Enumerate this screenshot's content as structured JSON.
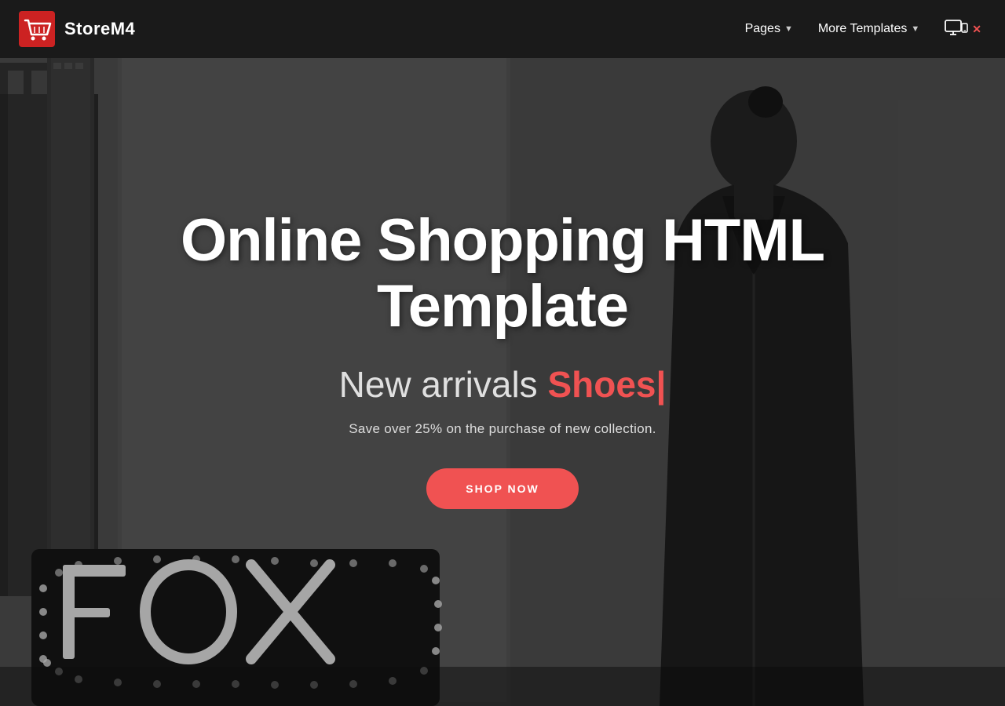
{
  "brand": {
    "name": "StoreM4",
    "icon_label": "shopping-cart-icon"
  },
  "navbar": {
    "pages_label": "Pages",
    "more_templates_label": "More Templates"
  },
  "hero": {
    "title": "Online Shopping HTML Template",
    "subtitle_prefix": "New arrivals ",
    "subtitle_highlight": "Shoes|",
    "description": "Save over 25% on the purchase of new collection.",
    "cta_label": "SHOP NOW"
  },
  "colors": {
    "accent": "#f05252",
    "navbar_bg": "#1a1a1a",
    "text_light": "#ffffff"
  }
}
